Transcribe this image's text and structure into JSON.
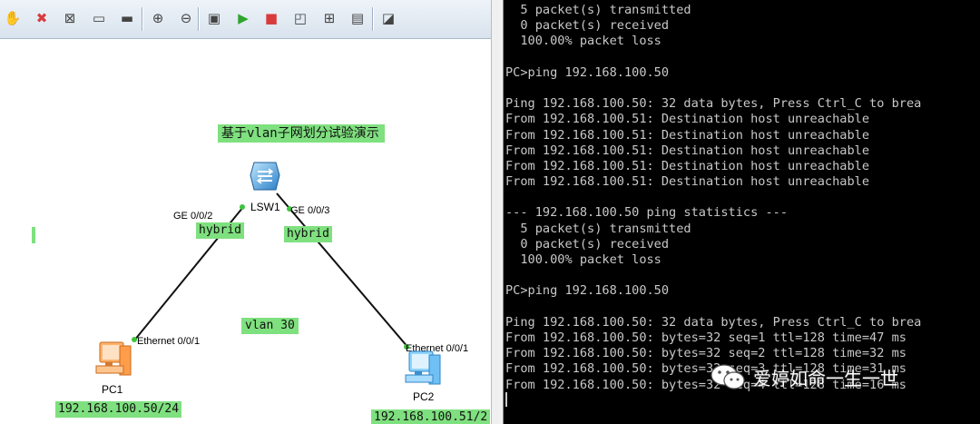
{
  "toolbar": {
    "buttons": [
      {
        "name": "hand-pan-icon",
        "glyph": "✋"
      },
      {
        "name": "delete-icon",
        "glyph": "✖"
      },
      {
        "name": "delete-all-icon",
        "glyph": "⊠"
      },
      {
        "name": "text-note-icon",
        "glyph": "▭"
      },
      {
        "name": "textbox-icon",
        "glyph": "▬"
      },
      {
        "name": "zoom-in-icon",
        "glyph": "⊕"
      },
      {
        "name": "zoom-out-icon",
        "glyph": "⊖"
      },
      {
        "name": "palette-icon",
        "glyph": "▣"
      },
      {
        "name": "start-device-icon",
        "glyph": "▶"
      },
      {
        "name": "stop-device-icon",
        "glyph": "■"
      },
      {
        "name": "capture-icon",
        "glyph": "◰"
      },
      {
        "name": "topology-icon",
        "glyph": "⊞"
      },
      {
        "name": "grid-icon",
        "glyph": "▤"
      },
      {
        "name": "cli-icon",
        "glyph": "◪"
      }
    ],
    "colors": {
      "start": "#2fa52f",
      "stop": "#d83b3b",
      "delete": "#d83b3b"
    }
  },
  "topology": {
    "title": "基于vlan子网划分试验演示",
    "switch": {
      "name": "LSW1"
    },
    "ports": {
      "sw_left": "GE 0/0/2",
      "sw_right": "GE 0/0/3",
      "pc1": "Ethernet 0/0/1",
      "pc2": "Ethernet 0/0/1"
    },
    "link_modes": {
      "left": "hybrid",
      "right": "hybrid"
    },
    "vlan_label": "vlan 30",
    "pc1": {
      "name": "PC1",
      "ip": "192.168.100.50/24"
    },
    "pc2": {
      "name": "PC2",
      "ip": "192.168.100.51/2"
    },
    "label_color": "#7fe07f"
  },
  "console": {
    "lines": [
      "  5 packet(s) transmitted",
      "  0 packet(s) received",
      "  100.00% packet loss",
      "",
      "PC>ping 192.168.100.50",
      "",
      "Ping 192.168.100.50: 32 data bytes, Press Ctrl_C to brea",
      "From 192.168.100.51: Destination host unreachable",
      "From 192.168.100.51: Destination host unreachable",
      "From 192.168.100.51: Destination host unreachable",
      "From 192.168.100.51: Destination host unreachable",
      "From 192.168.100.51: Destination host unreachable",
      "",
      "--- 192.168.100.50 ping statistics ---",
      "  5 packet(s) transmitted",
      "  0 packet(s) received",
      "  100.00% packet loss",
      "",
      "PC>ping 192.168.100.50",
      "",
      "Ping 192.168.100.50: 32 data bytes, Press Ctrl_C to brea",
      "From 192.168.100.50: bytes=32 seq=1 ttl=128 time=47 ms",
      "From 192.168.100.50: bytes=32 seq=2 ttl=128 time=32 ms",
      "From 192.168.100.50: bytes=32 seq=3 ttl=128 time=31 ms",
      "From 192.168.100.50: bytes=32 seq=4 ttl=128 time=16 ms"
    ]
  },
  "watermark": {
    "text": "爱婷如命一生一世",
    "icon": "wechat-icon"
  }
}
